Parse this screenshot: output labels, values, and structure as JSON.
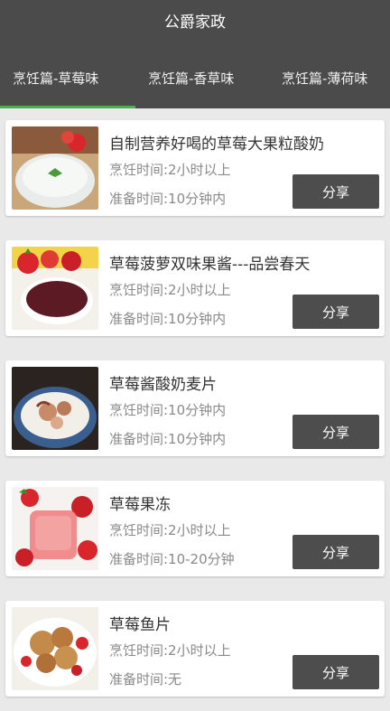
{
  "app": {
    "title": "公爵家政"
  },
  "tabs": [
    {
      "label": "烹饪篇-草莓味",
      "active": true
    },
    {
      "label": "烹饪篇-香草味",
      "active": false
    },
    {
      "label": "烹饪篇-薄荷味",
      "active": false
    }
  ],
  "recipes": [
    {
      "title": "自制营养好喝的草莓大果粒酸奶",
      "cook_time": "烹饪时间:2小时以上",
      "prep_time": "准备时间:10分钟内",
      "share_label": "分享",
      "thumb_icon": "yogurt-bowl-image"
    },
    {
      "title": "草莓菠萝双味果酱---品尝春天",
      "cook_time": "烹饪时间:2小时以上",
      "prep_time": "准备时间:10分钟内",
      "share_label": "分享",
      "thumb_icon": "strawberry-jam-image"
    },
    {
      "title": "草莓酱酸奶麦片",
      "cook_time": "烹饪时间:10分钟内",
      "prep_time": "准备时间:10分钟内",
      "share_label": "分享",
      "thumb_icon": "yogurt-oats-image"
    },
    {
      "title": "草莓果冻",
      "cook_time": "烹饪时间:2小时以上",
      "prep_time": "准备时间:10-20分钟",
      "share_label": "分享",
      "thumb_icon": "strawberry-jelly-image"
    },
    {
      "title": "草莓鱼片",
      "cook_time": "烹饪时间:2小时以上",
      "prep_time": "准备时间:无",
      "share_label": "分享",
      "thumb_icon": "strawberry-fish-image"
    }
  ],
  "colors": {
    "appbar": "#4b4b4b",
    "tab_indicator": "#4caf50",
    "button": "#4d4d4d",
    "background": "#e9e9e9"
  }
}
